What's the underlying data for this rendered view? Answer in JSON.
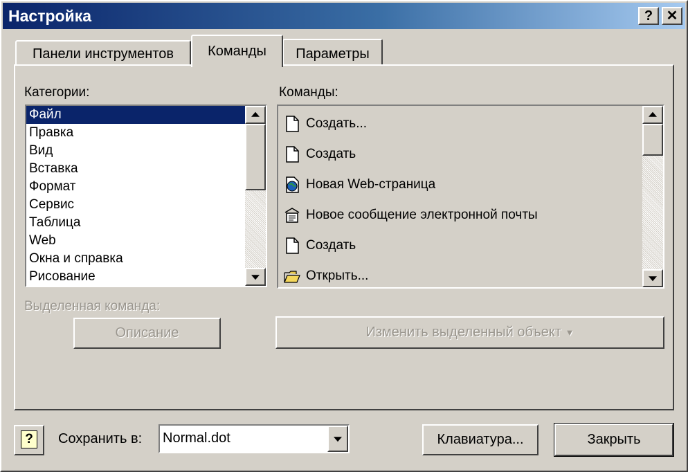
{
  "window": {
    "title": "Настройка",
    "help_button": "?",
    "close_button": "✕"
  },
  "tabs": [
    {
      "label": "Панели инструментов"
    },
    {
      "label": "Команды"
    },
    {
      "label": "Параметры"
    }
  ],
  "categories": {
    "label": "Категории:",
    "selected": "Файл",
    "items": [
      "Файл",
      "Правка",
      "Вид",
      "Вставка",
      "Формат",
      "Сервис",
      "Таблица",
      "Web",
      "Окна и справка",
      "Рисование"
    ]
  },
  "commands": {
    "label": "Команды:",
    "items": [
      {
        "label": "Создать...",
        "icon": "document-icon"
      },
      {
        "label": "Создать",
        "icon": "document-icon"
      },
      {
        "label": "Новая Web-страница",
        "icon": "web-page-icon"
      },
      {
        "label": "Новое сообщение электронной почты",
        "icon": "email-message-icon"
      },
      {
        "label": "Создать",
        "icon": "document-icon"
      },
      {
        "label": "Открыть...",
        "icon": "open-folder-icon"
      }
    ]
  },
  "selected_command": {
    "label": "Выделенная команда:",
    "description_button": "Описание",
    "modify_button": "Изменить выделенный объект"
  },
  "footer": {
    "save_in_label": "Сохранить в:",
    "save_in_value": "Normal.dot",
    "keyboard_button": "Клавиатура...",
    "close_button": "Закрыть"
  }
}
